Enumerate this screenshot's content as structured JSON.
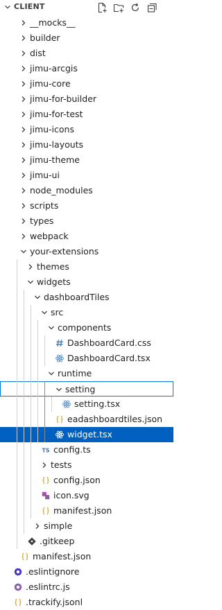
{
  "header": {
    "title": "CLIENT"
  },
  "tree": [
    {
      "label": "__mocks__",
      "type": "folder",
      "expanded": false
    },
    {
      "label": "builder",
      "type": "folder",
      "expanded": false
    },
    {
      "label": "dist",
      "type": "folder",
      "expanded": false
    },
    {
      "label": "jimu-arcgis",
      "type": "folder",
      "expanded": false
    },
    {
      "label": "jimu-core",
      "type": "folder",
      "expanded": false
    },
    {
      "label": "jimu-for-builder",
      "type": "folder",
      "expanded": false
    },
    {
      "label": "jimu-for-test",
      "type": "folder",
      "expanded": false
    },
    {
      "label": "jimu-icons",
      "type": "folder",
      "expanded": false
    },
    {
      "label": "jimu-layouts",
      "type": "folder",
      "expanded": false
    },
    {
      "label": "jimu-theme",
      "type": "folder",
      "expanded": false
    },
    {
      "label": "jimu-ui",
      "type": "folder",
      "expanded": false
    },
    {
      "label": "node_modules",
      "type": "folder",
      "expanded": false
    },
    {
      "label": "scripts",
      "type": "folder",
      "expanded": false
    },
    {
      "label": "types",
      "type": "folder",
      "expanded": false
    },
    {
      "label": "webpack",
      "type": "folder",
      "expanded": false
    },
    {
      "label": "your-extensions",
      "type": "folder",
      "expanded": true
    },
    {
      "label": "themes",
      "type": "folder",
      "expanded": false
    },
    {
      "label": "widgets",
      "type": "folder",
      "expanded": true
    },
    {
      "label": "dashboardTiles",
      "type": "folder",
      "expanded": true
    },
    {
      "label": "src",
      "type": "folder",
      "expanded": true
    },
    {
      "label": "components",
      "type": "folder",
      "expanded": true
    },
    {
      "label": "DashboardCard.css",
      "type": "file",
      "icon": "css-hash-icon",
      "color": "#4a7fc1"
    },
    {
      "label": "DashboardCard.tsx",
      "type": "file",
      "icon": "react-icon",
      "color": "#5a8ec9"
    },
    {
      "label": "runtime",
      "type": "folder",
      "expanded": true
    },
    {
      "label": "setting",
      "type": "folder",
      "expanded": true,
      "focused": true
    },
    {
      "label": "setting.tsx",
      "type": "file",
      "icon": "react-icon",
      "color": "#5a8ec9"
    },
    {
      "label": "eadashboardtiles.json",
      "type": "file",
      "icon": "json-braces-icon",
      "color": "#c9a227"
    },
    {
      "label": "widget.tsx",
      "type": "file",
      "icon": "react-icon",
      "color": "#5a8ec9",
      "selected": true
    },
    {
      "label": "config.ts",
      "type": "file",
      "icon": "ts-icon",
      "color": "#3178c6"
    },
    {
      "label": "tests",
      "type": "folder",
      "expanded": false
    },
    {
      "label": "config.json",
      "type": "file",
      "icon": "json-braces-icon",
      "color": "#c9a227"
    },
    {
      "label": "icon.svg",
      "type": "file",
      "icon": "svg-icon",
      "color": "#b04fb0"
    },
    {
      "label": "manifest.json",
      "type": "file",
      "icon": "json-braces-icon",
      "color": "#c9a227"
    },
    {
      "label": "simple",
      "type": "folder",
      "expanded": false
    },
    {
      "label": ".gitkeep",
      "type": "file",
      "icon": "diamond-icon",
      "color": "#3b3b3b"
    },
    {
      "label": "manifest.json",
      "type": "file",
      "icon": "json-braces-icon",
      "color": "#c9a227"
    },
    {
      "label": ".eslintignore",
      "type": "file",
      "icon": "eslint-dot-icon",
      "color": "#4b32c3"
    },
    {
      "label": ".eslintrc.js",
      "type": "file",
      "icon": "eslint-dot-icon",
      "color": "#8a5fb0"
    },
    {
      "label": ".trackify.jsonl",
      "type": "file",
      "icon": "json-braces-icon",
      "color": "#c9a227"
    }
  ]
}
